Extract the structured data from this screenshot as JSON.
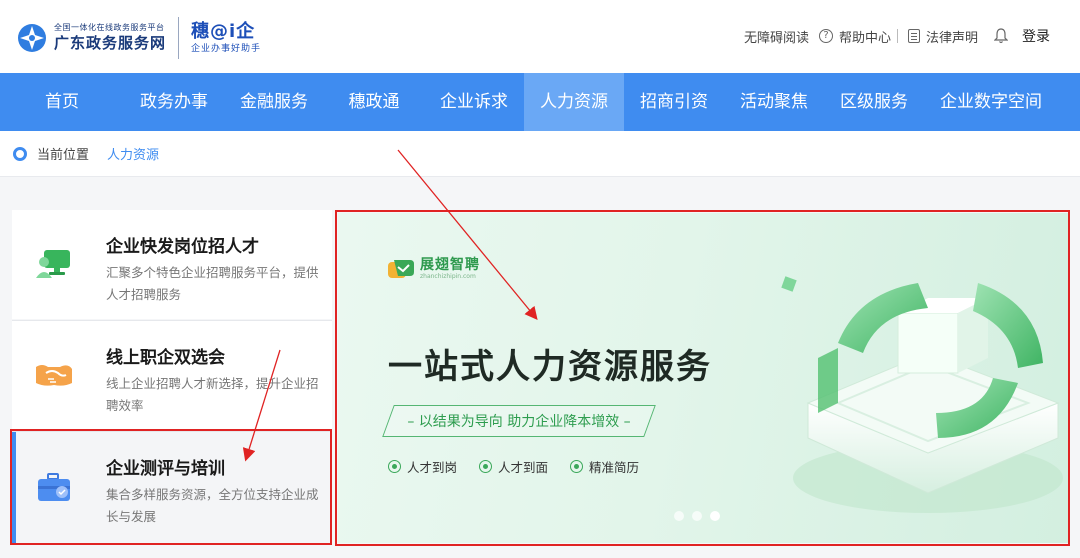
{
  "header": {
    "logo_small": "全国一体化在线政务服务平台",
    "logo_main": "广东政务服务网",
    "brand2_main": "穗@i企",
    "brand2_sub": "企业办事好助手",
    "links": {
      "accessibility": "无障碍阅读",
      "help": "帮助中心",
      "legal": "法律声明",
      "login": "登录"
    }
  },
  "nav": {
    "items": [
      "首页",
      "政务办事",
      "金融服务",
      "穗政通",
      "企业诉求",
      "人力资源",
      "招商引资",
      "活动聚焦",
      "区级服务",
      "企业数字空间"
    ],
    "active": "人力资源"
  },
  "breadcrumb": {
    "label": "当前位置",
    "current": "人力资源"
  },
  "cards": [
    {
      "title": "企业快发岗位招人才",
      "desc": "汇聚多个特色企业招聘服务平台，提供人才招聘服务",
      "icon": "monitor-person-icon"
    },
    {
      "title": "线上职企双选会",
      "desc": "线上企业招聘人才新选择，提升企业招聘效率",
      "icon": "handshake-icon"
    },
    {
      "title": "企业测评与培训",
      "desc": "集合多样服务资源，全方位支持企业成长与发展",
      "icon": "briefcase-icon"
    }
  ],
  "banner": {
    "logo_main": "展翅智聘",
    "logo_sub": "zhanchizhipin.com",
    "title": "一站式人力资源服务",
    "slogan": "– 以结果为导向 助力企业降本增效 –",
    "tags": [
      "人才到岗",
      "人才到面",
      "精准简历"
    ],
    "slides": 3,
    "active_slide": 3
  },
  "colors": {
    "nav_bg": "#3f8cf0",
    "nav_active": "#6aa8f5",
    "accent_green": "#2f9a4e",
    "highlight_red": "#e02323"
  }
}
